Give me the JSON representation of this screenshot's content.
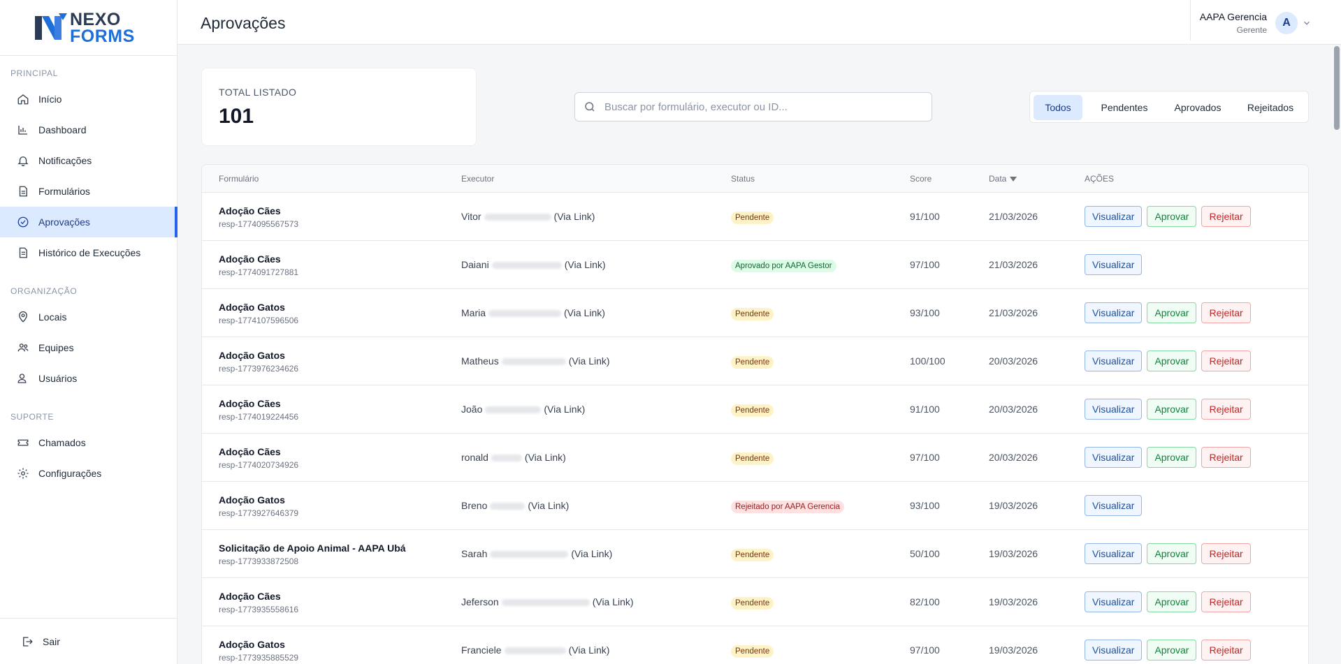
{
  "brand": {
    "line1": "NEXO",
    "line2": "FORMS"
  },
  "sidebar": {
    "sections": {
      "principal": "PRINCIPAL",
      "organizacao": "ORGANIZAÇÃO",
      "suporte": "SUPORTE"
    },
    "items": [
      {
        "label": "Início",
        "icon": "home-icon"
      },
      {
        "label": "Dashboard",
        "icon": "bar-chart-icon"
      },
      {
        "label": "Notificações",
        "icon": "bell-icon"
      },
      {
        "label": "Formulários",
        "icon": "document-icon"
      },
      {
        "label": "Aprovações",
        "icon": "check-circle-icon",
        "active": true
      },
      {
        "label": "Histórico de Execuções",
        "icon": "history-icon"
      },
      {
        "label": "Locais",
        "icon": "map-pin-icon"
      },
      {
        "label": "Equipes",
        "icon": "team-icon"
      },
      {
        "label": "Usuários",
        "icon": "users-icon"
      },
      {
        "label": "Chamados",
        "icon": "ticket-icon"
      },
      {
        "label": "Configurações",
        "icon": "gear-icon"
      }
    ],
    "logout": "Sair"
  },
  "header": {
    "title": "Aprovações",
    "user_name": "AAPA Gerencia",
    "user_role": "Gerente",
    "avatar_initial": "A"
  },
  "stats": {
    "label": "TOTAL LISTADO",
    "value": "101"
  },
  "search": {
    "placeholder": "Buscar por formulário, executor ou ID..."
  },
  "filters": [
    "Todos",
    "Pendentes",
    "Aprovados",
    "Rejeitados"
  ],
  "table": {
    "headers": {
      "form": "Formulário",
      "executor": "Executor",
      "status": "Status",
      "score": "Score",
      "date": "Data",
      "actions": "AÇÕES"
    },
    "action_labels": {
      "view": "Visualizar",
      "approve": "Aprovar",
      "reject": "Rejeitar"
    },
    "rows": [
      {
        "form": "Adoção Cães",
        "id": "resp-1774095567573",
        "exec_first": "Vitor",
        "exec_suffix": "(Via Link)",
        "status": "Pendente",
        "status_type": "pend",
        "score": "91/100",
        "date": "21/03/2026"
      },
      {
        "form": "Adoção Cães",
        "id": "resp-1774091727881",
        "exec_first": "Daiani",
        "exec_suffix": "(Via Link)",
        "status": "Aprovado por AAPA Gestor",
        "status_type": "appr",
        "score": "97/100",
        "date": "21/03/2026"
      },
      {
        "form": "Adoção Gatos",
        "id": "resp-1774107596506",
        "exec_first": "Maria",
        "exec_suffix": "(Via Link)",
        "status": "Pendente",
        "status_type": "pend",
        "score": "93/100",
        "date": "21/03/2026"
      },
      {
        "form": "Adoção Gatos",
        "id": "resp-1773976234626",
        "exec_first": "Matheus",
        "exec_suffix": "(Via Link)",
        "status": "Pendente",
        "status_type": "pend",
        "score": "100/100",
        "date": "20/03/2026"
      },
      {
        "form": "Adoção Cães",
        "id": "resp-1774019224456",
        "exec_first": "João",
        "exec_suffix": "(Via Link)",
        "status": "Pendente",
        "status_type": "pend",
        "score": "91/100",
        "date": "20/03/2026"
      },
      {
        "form": "Adoção Cães",
        "id": "resp-1774020734926",
        "exec_first": "ronald",
        "exec_suffix": "(Via Link)",
        "status": "Pendente",
        "status_type": "pend",
        "score": "97/100",
        "date": "20/03/2026"
      },
      {
        "form": "Adoção Gatos",
        "id": "resp-1773927646379",
        "exec_first": "Breno",
        "exec_suffix": "(Via Link)",
        "status": "Rejeitado por AAPA Gerencia",
        "status_type": "rej",
        "score": "93/100",
        "date": "19/03/2026"
      },
      {
        "form": "Solicitação de Apoio Animal - AAPA Ubá",
        "id": "resp-1773933872508",
        "exec_first": "Sarah",
        "exec_suffix": "(Via Link)",
        "status": "Pendente",
        "status_type": "pend",
        "score": "50/100",
        "date": "19/03/2026"
      },
      {
        "form": "Adoção Cães",
        "id": "resp-1773935558616",
        "exec_first": "Jeferson",
        "exec_suffix": "(Via Link)",
        "status": "Pendente",
        "status_type": "pend",
        "score": "82/100",
        "date": "19/03/2026"
      },
      {
        "form": "Adoção Gatos",
        "id": "resp-1773935885529",
        "exec_first": "Franciele",
        "exec_suffix": "(Via Link)",
        "status": "Pendente",
        "status_type": "pend",
        "score": "97/100",
        "date": "19/03/2026"
      }
    ]
  },
  "colors": {
    "accent": "#2563eb",
    "active_bg": "#dbeafe",
    "brand_dark": "#2b3a55",
    "brand_blue": "#1e6fd9"
  }
}
